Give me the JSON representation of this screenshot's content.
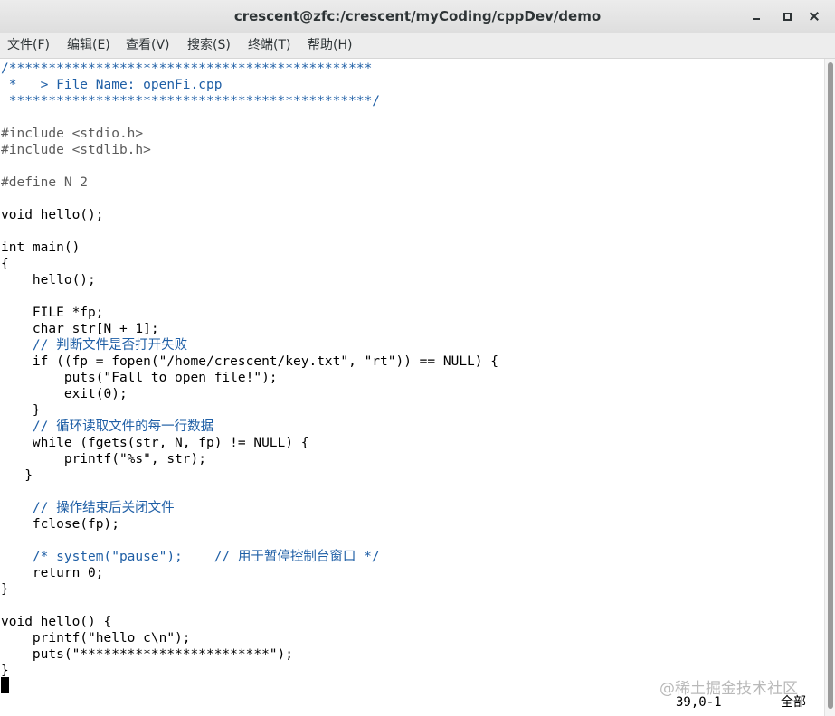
{
  "window": {
    "title": "crescent@zfc:/crescent/myCoding/cppDev/demo"
  },
  "menu": [
    {
      "label": "文件(F)"
    },
    {
      "label": "编辑(E)"
    },
    {
      "label": "查看(V)"
    },
    {
      "label": "搜索(S)"
    },
    {
      "label": "终端(T)"
    },
    {
      "label": "帮助(H)"
    }
  ],
  "code": {
    "lines": [
      "/**********************************************",
      " *   > File Name: openFi.cpp",
      " **********************************************/",
      "",
      "#include <stdio.h>",
      "#include <stdlib.h>",
      "",
      "#define N 2",
      "",
      "void hello();",
      "",
      "int main()",
      "{",
      "    hello();",
      "",
      "    FILE *fp;",
      "    char str[N + 1];",
      "    // 判断文件是否打开失败",
      "    if ((fp = fopen(\"/home/crescent/key.txt\", \"rt\")) == NULL) {",
      "        puts(\"Fall to open file!\");",
      "        exit(0);",
      "    }",
      "    // 循环读取文件的每一行数据",
      "    while (fgets(str, N, fp) != NULL) {",
      "        printf(\"%s\", str);",
      "   }",
      "",
      "    // 操作结束后关闭文件",
      "    fclose(fp);",
      "",
      "    /* system(\"pause\");    // 用于暂停控制台窗口 */",
      "    return 0;",
      "}",
      "",
      "void hello() {",
      "    printf(\"hello c\\n\");",
      "    puts(\"************************\");",
      "}"
    ]
  },
  "status": {
    "position": "39,0-1",
    "scroll": "全部"
  },
  "watermark": "@稀土掘金技术社区",
  "colors": {
    "comment": "#1f5fa6",
    "preprocessor": "#5c5c5c",
    "string": "#c00000",
    "keyword": "#2e8b57"
  }
}
